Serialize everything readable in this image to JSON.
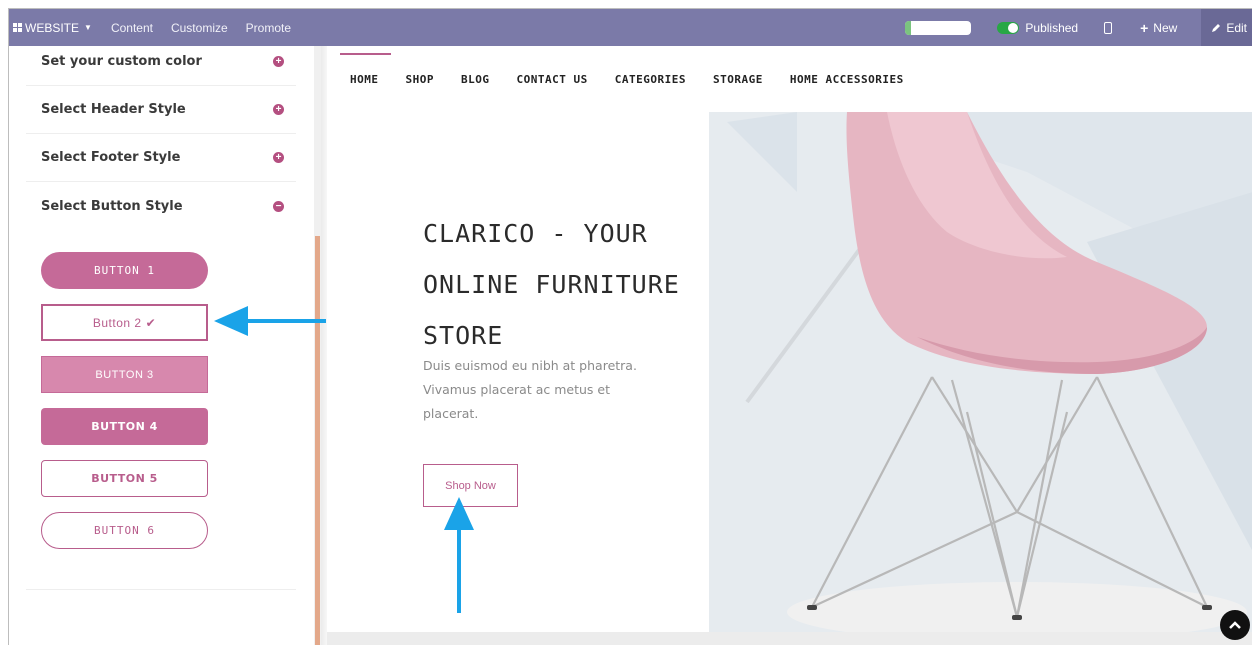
{
  "topbar": {
    "website_label": "WEBSITE",
    "menu": [
      "Content",
      "Customize",
      "Promote"
    ],
    "progress_percent": 8,
    "published_label": "Published",
    "new_label": "New",
    "edit_label": "Edit"
  },
  "sidebar": {
    "rows": [
      {
        "label": "Set your custom color",
        "icon": "plus"
      },
      {
        "label": "Select Header Style",
        "icon": "plus"
      },
      {
        "label": "Select Footer Style",
        "icon": "plus"
      },
      {
        "label": "Select Button Style",
        "icon": "minus"
      }
    ],
    "buttons": [
      "BUTTON 1",
      "Button 2",
      "BUTTON 3",
      "BUTTON 4",
      "BUTTON 5",
      "BUTTON 6"
    ],
    "selected_button": "Button 2"
  },
  "nav": {
    "items": [
      "HOME",
      "SHOP",
      "BLOG",
      "CONTACT US",
      "CATEGORIES",
      "STORAGE",
      "HOME ACCESSORIES"
    ],
    "active": "HOME"
  },
  "hero": {
    "title_lines": [
      "CLARICO - YOUR",
      "ONLINE FURNITURE",
      "STORE"
    ],
    "subtitle_lines": [
      "Duis euismod eu nibh at pharetra.",
      "Vivamus placerat ac metus et",
      "placerat."
    ],
    "cta": "Shop Now"
  },
  "colors": {
    "topbar": "#7b7aa8",
    "accent": "#b85d8c",
    "annotation_arrow": "#1aa3e8"
  }
}
